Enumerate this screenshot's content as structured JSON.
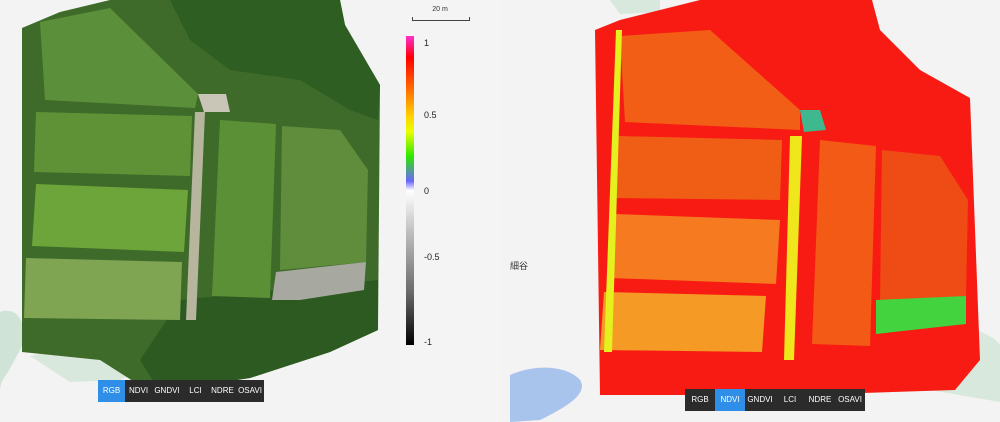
{
  "scale": {
    "label": "20 m"
  },
  "colorbar": {
    "ticks": [
      "1",
      "0.5",
      "0",
      "-0.5",
      "-1"
    ]
  },
  "center_label": "細谷",
  "left_toolbar": {
    "buttons": [
      "RGB",
      "NDVI",
      "GNDVI",
      "LCI",
      "NDRE",
      "OSAVI"
    ],
    "active": "RGB"
  },
  "right_toolbar": {
    "buttons": [
      "RGB",
      "NDVI",
      "GNDVI",
      "LCI",
      "NDRE",
      "OSAVI"
    ],
    "active": "NDVI"
  },
  "colors": {
    "accent": "#2f8fe8",
    "toolbar_bg": "#2b2b2b",
    "water": "#cfe3d6"
  }
}
